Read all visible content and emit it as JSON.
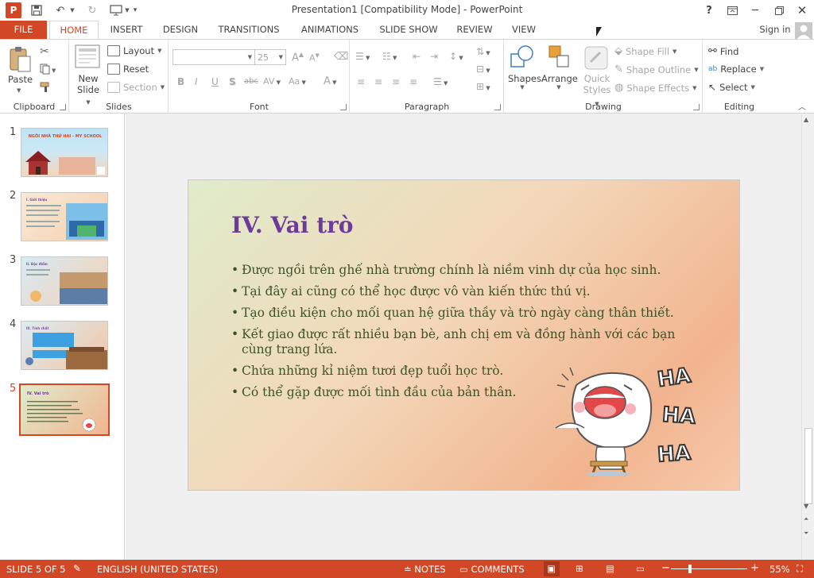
{
  "window": {
    "title": "Presentation1 [Compatibility Mode] - PowerPoint",
    "app_logo": "P",
    "help": "?",
    "sign_in": "Sign in"
  },
  "tabs": [
    "FILE",
    "HOME",
    "INSERT",
    "DESIGN",
    "TRANSITIONS",
    "ANIMATIONS",
    "SLIDE SHOW",
    "REVIEW",
    "VIEW"
  ],
  "ribbon": {
    "clipboard": {
      "label": "Clipboard",
      "paste": "Paste"
    },
    "slides": {
      "label": "Slides",
      "new_slide_1": "New",
      "new_slide_2": "Slide",
      "layout": "Layout",
      "reset": "Reset",
      "section": "Section"
    },
    "font": {
      "label": "Font",
      "font_name": "",
      "font_size": "25",
      "bold": "B",
      "italic": "I",
      "underline": "U",
      "shadow": "S",
      "strike": "abc",
      "spacing": "AV",
      "case": "Aa",
      "color": "A",
      "grow": "A",
      "shrink": "A"
    },
    "paragraph": {
      "label": "Paragraph"
    },
    "drawing": {
      "label": "Drawing",
      "shapes": "Shapes",
      "arrange": "Arrange",
      "quick_styles_1": "Quick",
      "quick_styles_2": "Styles",
      "shape_fill": "Shape Fill",
      "shape_outline": "Shape Outline",
      "shape_effects": "Shape Effects"
    },
    "editing": {
      "label": "Editing",
      "find": "Find",
      "replace": "Replace",
      "select": "Select"
    }
  },
  "thumbnails": [
    {
      "num": "1",
      "text": "NGÔI NHÀ THỨ HAI - MY SCHOOL"
    },
    {
      "num": "2",
      "text": "I. Giới thiệu"
    },
    {
      "num": "3",
      "text": "II. Đặc điểm"
    },
    {
      "num": "4",
      "text": "III. Tính chất"
    },
    {
      "num": "5",
      "text": "IV. Vai trò"
    }
  ],
  "slide": {
    "title": "IV. Vai trò",
    "bullets": [
      "Được ngồi trên ghế nhà trường chính là niềm vinh dự của học sinh.",
      "Tại đây ai cũng có thể học được vô vàn kiến thức thú vị.",
      "Tạo điều kiện cho mối quan hệ giữa thầy và trò ngày càng thân thiết.",
      "Kết giao được rất nhiều bạn bè, anh chị em và đồng hành với các bạn cùng trang lứa.",
      "Chứa những kỉ niệm tươi đẹp tuổi học trò.",
      "Có thể gặp được mối tình đầu của bản thân."
    ],
    "sticker": [
      "HA",
      "HA",
      "HA"
    ]
  },
  "status": {
    "slide_of": "SLIDE 5 OF 5",
    "language": "ENGLISH (UNITED STATES)",
    "notes": "NOTES",
    "comments": "COMMENTS",
    "zoom_minus": "−",
    "zoom_plus": "+",
    "zoom": "55%"
  },
  "colors": {
    "accent": "#d24726",
    "title_purple": "#6d3b9a",
    "bullet_green": "#3e5327"
  }
}
